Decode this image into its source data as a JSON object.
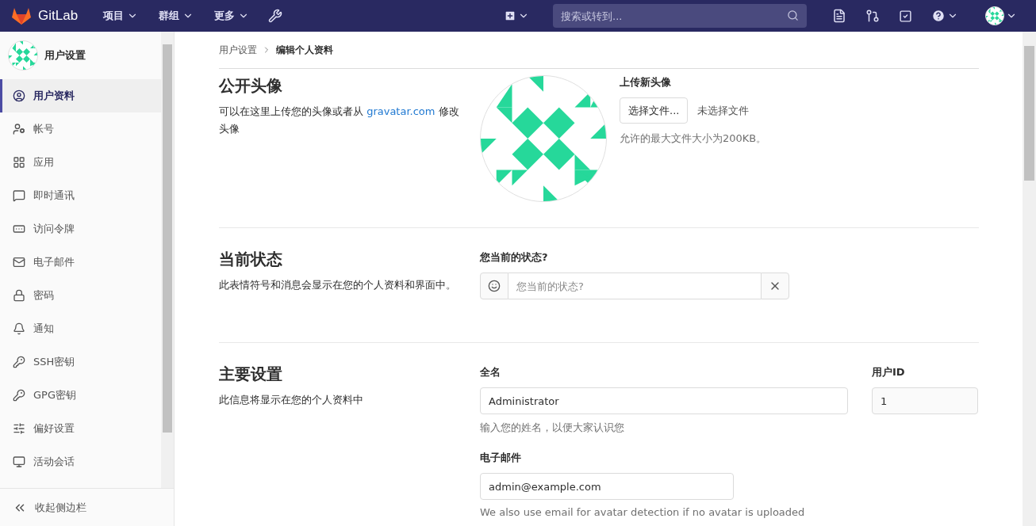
{
  "topbar": {
    "brand": "GitLab",
    "menus": [
      {
        "label": "项目"
      },
      {
        "label": "群组"
      },
      {
        "label": "更多"
      }
    ],
    "search": {
      "placeholder": "搜索或转到..."
    }
  },
  "sidebar": {
    "title": "用户设置",
    "items": [
      {
        "label": "用户资料",
        "selected": true
      },
      {
        "label": "帐号",
        "selected": false
      },
      {
        "label": "应用",
        "selected": false
      },
      {
        "label": "即时通讯",
        "selected": false
      },
      {
        "label": "访问令牌",
        "selected": false
      },
      {
        "label": "电子邮件",
        "selected": false
      },
      {
        "label": "密码",
        "selected": false
      },
      {
        "label": "通知",
        "selected": false
      },
      {
        "label": "SSH密钥",
        "selected": false
      },
      {
        "label": "GPG密钥",
        "selected": false
      },
      {
        "label": "偏好设置",
        "selected": false
      },
      {
        "label": "活动会话",
        "selected": false
      }
    ],
    "collapse": "收起侧边栏"
  },
  "breadcrumb": [
    {
      "label": "用户设置",
      "current": false
    },
    {
      "label": "编辑个人资料",
      "current": true
    }
  ],
  "sections": [
    {
      "kind": "avatar",
      "title": "公开头像",
      "description": "可以在这里上传您的头像或者从 ",
      "link": "gravatar.com",
      "description_end": " 修改头像",
      "upload_title": "上传新头像",
      "choose_button": "选择文件...",
      "no_file": "未选择文件",
      "hint": "允许的最大文件大小为200KB。"
    },
    {
      "kind": "status",
      "title": "当前状态",
      "description": "此表情符号和消息会显示在您的个人资料和界面中。",
      "label": "您当前的状态?",
      "placeholder": "您当前的状态?"
    },
    {
      "kind": "main",
      "title": "主要设置",
      "description": "此信息将显示在您的个人资料中",
      "name_label": "全名",
      "name_value": "Administrator",
      "name_hint": "输入您的姓名，以便大家认识您",
      "id_label": "用户ID",
      "id_value": "1",
      "email_label": "电子邮件",
      "email_value": "admin@example.com",
      "email_hint": "We also use email for avatar detection if no avatar is uploaded"
    }
  ]
}
